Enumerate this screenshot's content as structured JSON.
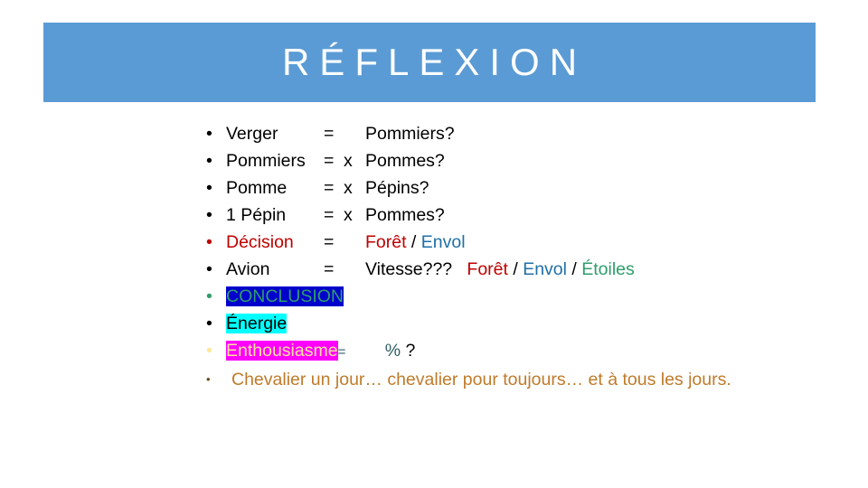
{
  "slide": {
    "background_color": "#FFFFFF",
    "title": {
      "text": "RÉFLEXION",
      "banner_color": "#5B9BD5",
      "text_color": "#FFFFFF"
    },
    "bullets": [
      {
        "id": "verger",
        "marker": "•",
        "marker_color": "#000000",
        "term": "Verger",
        "equals": "=",
        "multiplier": "",
        "result": "Pommiers?"
      },
      {
        "id": "pommiers",
        "marker": "•",
        "marker_color": "#000000",
        "term": "Pommiers",
        "equals": "=",
        "multiplier": "x",
        "result": "Pommes?"
      },
      {
        "id": "pomme",
        "marker": "•",
        "marker_color": "#000000",
        "term": "Pomme",
        "equals": "=",
        "multiplier": "x",
        "result": "Pépins?"
      },
      {
        "id": "pepin",
        "marker": "•",
        "marker_color": "#000000",
        "term": "1 Pépin",
        "equals": "=",
        "multiplier": "x",
        "result": "Pommes?"
      },
      {
        "id": "decision",
        "marker": "•",
        "marker_color": "#C00000",
        "term": "Décision",
        "equals": "=",
        "foret": "Forêt",
        "sep1": " / ",
        "envol": "Envol"
      },
      {
        "id": "avion",
        "marker": "•",
        "marker_color": "#000000",
        "term": "Avion",
        "equals": "=",
        "vitesse": "Vitesse???",
        "gap": "   ",
        "foret": "Forêt",
        "sep1": " / ",
        "envol": "Envol",
        "sep2": " / ",
        "etoiles": "Étoiles"
      },
      {
        "id": "conclusion",
        "marker": "•",
        "marker_color": "#2E9E6B",
        "text": "CONCLUSION",
        "text_color": "#2E9E6B",
        "highlight_color": "#0000CC"
      },
      {
        "id": "energie",
        "marker": "•",
        "marker_color": "#000000",
        "text": "Énergie",
        "text_color": "#000000",
        "highlight_color": "#00FFFF"
      },
      {
        "id": "enthousiasme",
        "marker": "•",
        "marker_color": "#FFE699",
        "text": "Enthousiasme",
        "text_color": "#FFE699",
        "highlight_color": "#FF00FF",
        "equals": "=",
        "percent": "%",
        "question": "?"
      },
      {
        "id": "chevalier",
        "marker": "•",
        "marker_color": "#6B4A1F",
        "text": "Chevalier un jour…  chevalier pour toujours…  et à tous les jours.",
        "text_color": "#BF7B2A"
      }
    ]
  }
}
